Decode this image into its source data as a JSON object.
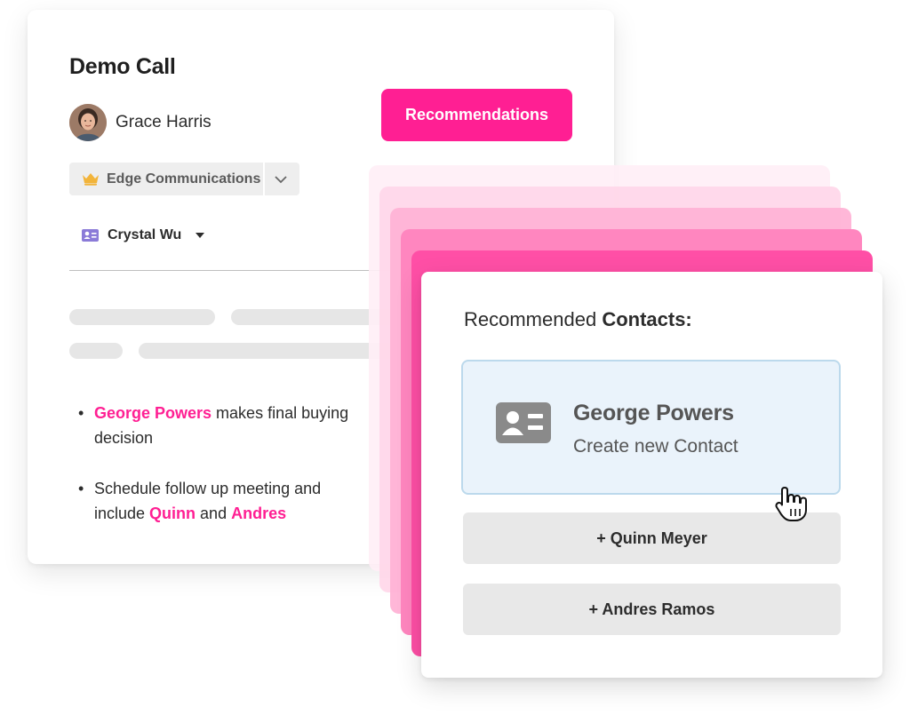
{
  "back_card": {
    "title": "Demo Call",
    "person": {
      "name": "Grace Harris",
      "avatar_icon": "user-photo-avatar"
    },
    "recommendations_button": "Recommendations",
    "account": {
      "label": "Edge Communications",
      "icon": "crown-icon"
    },
    "contact_selector": {
      "label": "Crystal Wu",
      "icon": "contact-card-icon"
    },
    "notes": [
      {
        "highlight": "George Powers",
        "text": " makes final buying decision"
      },
      {
        "prefix": "Schedule follow up meeting and include ",
        "highlight1": "Quinn",
        "middle": " and ",
        "highlight2": "Andres"
      }
    ]
  },
  "front_card": {
    "heading_prefix": "Recommended ",
    "heading_bold": "Contacts:",
    "primary_contact": {
      "name": "George Powers",
      "subtitle": "Create new Contact"
    },
    "add_buttons": [
      "+ Quinn Meyer",
      "+ Andres Ramos"
    ]
  },
  "colors": {
    "brand_pink": "#ff1f93",
    "card_highlight": "#eaf3fb",
    "button_gray": "#e8e8e8"
  }
}
